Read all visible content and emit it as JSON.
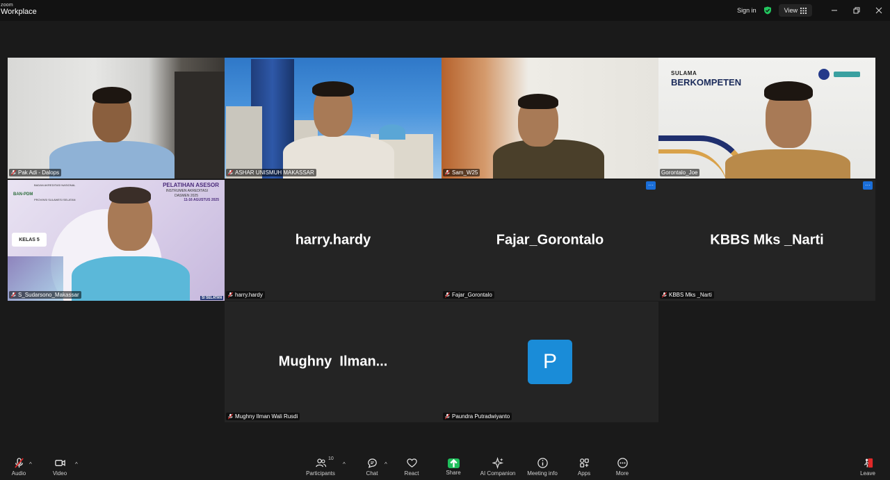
{
  "app": {
    "logo_top": "zoom",
    "logo_bottom": "Workplace"
  },
  "titlebar": {
    "sign_in": "Sign in",
    "view": "View"
  },
  "tiles": [
    {
      "name": "Pak Adi - Dalops",
      "type": "video"
    },
    {
      "name": "ASHAR UNISMUH MAKASSAR",
      "type": "video",
      "active": true
    },
    {
      "name": "Sam_W25",
      "type": "video"
    },
    {
      "name": "Gorontalo_Joe",
      "type": "video",
      "banner_line1": "SULAMA",
      "banner_line2": "BERKOMPETEN"
    },
    {
      "name": "S_Sudarsono_Makassar",
      "type": "video",
      "banner_title": "PELATIHAN ASESOR",
      "banner_sub1": "INSTRUMEN AKREDITASI",
      "banner_sub2": "DASMEN 2025",
      "banner_date": "11-16 AGUSTUS 2025",
      "banner_org": "BAN-PDM",
      "banner_org_full": "BADAN AKREDITASI NASIONAL",
      "banner_prov": "PROVINSI SULAWESI SELATAN",
      "banner_kelas": "KELAS 5",
      "banner_footer": "SI SELATAN"
    },
    {
      "name": "harry.hardy",
      "display": "harry.hardy",
      "type": "name"
    },
    {
      "name": "Fajar_Gorontalo",
      "display": "Fajar_Gorontalo",
      "type": "name"
    },
    {
      "name": "KBBS Mks _Narti",
      "display": "KBBS Mks _Narti",
      "type": "name"
    },
    {
      "name": "Mughny Ilman Wali Rusdi",
      "display": "Mughny  Ilman...",
      "type": "name"
    },
    {
      "name": "Paundra Putradwiyanto",
      "avatar_letter": "P",
      "type": "avatar"
    }
  ],
  "toolbar": {
    "audio": "Audio",
    "video": "Video",
    "participants": "Participants",
    "participants_count": "10",
    "chat": "Chat",
    "react": "React",
    "share": "Share",
    "ai_companion": "AI Companion",
    "meeting_info": "Meeting info",
    "apps": "Apps",
    "more": "More",
    "leave": "Leave"
  },
  "colors": {
    "active_border": "#2dd36f",
    "accent_blue": "#1a6ed8",
    "share_green": "#1fbf5c",
    "leave_red": "#e02828",
    "avatar_blue": "#1a8cd8"
  }
}
